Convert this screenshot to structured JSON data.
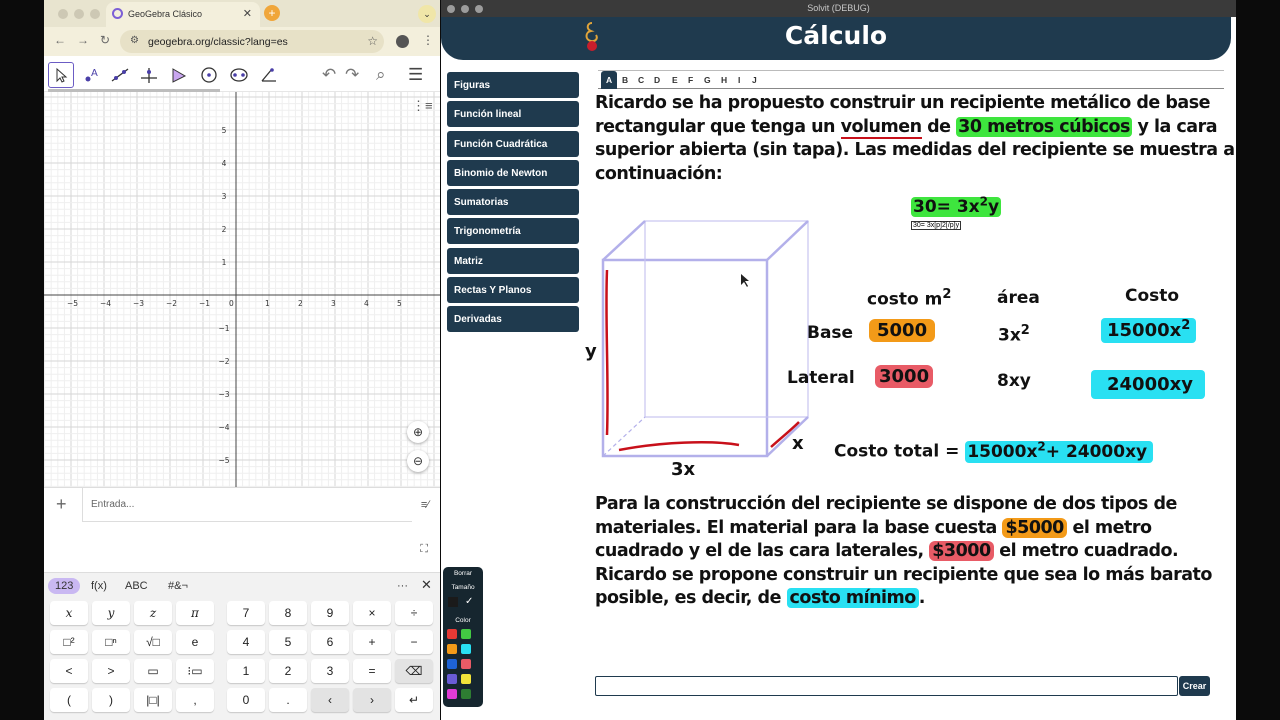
{
  "browser": {
    "tab_title": "GeoGebra Clásico",
    "url": "geogebra.org/classic?lang=es"
  },
  "geogebra": {
    "axis_x_ticks": [
      "−5",
      "−4",
      "−3",
      "−2",
      "−1",
      "0",
      "1",
      "2",
      "3",
      "4",
      "5"
    ],
    "axis_y_ticks": [
      "5",
      "4",
      "3",
      "2",
      "1",
      "−1",
      "−2",
      "−3",
      "−4",
      "−5"
    ],
    "input_placeholder": "Entrada...",
    "keyboard_tabs": [
      "123",
      "f(x)",
      "ABC",
      "#&¬"
    ],
    "keyboard_rows": [
      [
        "x",
        "y",
        "z",
        "π",
        "7",
        "8",
        "9",
        "×",
        "÷"
      ],
      [
        "□²",
        "□ⁿ",
        "√□",
        "e",
        "4",
        "5",
        "6",
        "+",
        "−"
      ],
      [
        "<",
        ">",
        "▭",
        "⁝▭",
        "1",
        "2",
        "3",
        "=",
        "⌫"
      ],
      [
        "(",
        ")",
        "|□|",
        ",",
        "0",
        ".",
        "‹",
        "›",
        "↵"
      ]
    ]
  },
  "solvit": {
    "window_title": "Solvit (DEBUG)",
    "header_title": "Cálculo",
    "menu": [
      "Figuras",
      "Función lineal",
      "Función Cuadrática",
      "Binomio de Newton",
      "Sumatorias",
      "Trigonometría",
      "Matriz",
      "Rectas Y Planos",
      "Derivadas"
    ],
    "tabs": [
      "A",
      "B",
      "C",
      "D",
      "E",
      "F",
      "G",
      "H",
      "I",
      "J"
    ],
    "p1": {
      "a": "Ricardo se ha propuesto construir un recipiente metálico de base",
      "b1": "rectangular que tenga un ",
      "b2": "volumen",
      "b3": " de ",
      "b4": "30 metros cúbicos",
      "b5": " y la cara",
      "c": "superior abierta (sin tapa). Las medidas del recipiente se muestra a",
      "d": "continuación:"
    },
    "equation": "30= 3x",
    "equation_exp": "2",
    "equation_tail": "y",
    "latex_source": "30= 3x[p]2[/p]y",
    "label_y": "y",
    "label_x": "x",
    "label_3x": "3x",
    "col_costo_m2": "costo m",
    "col_costo_m2_exp": "2",
    "col_area": "área",
    "col_costo": "Costo",
    "row_base": "Base",
    "row_lateral": "Lateral",
    "base_cost": "5000",
    "lateral_cost": "3000",
    "base_area": "3x",
    "base_area_exp": "2",
    "lateral_area": "8xy",
    "base_total": "15000x",
    "base_total_exp": "2",
    "lateral_total": "24000xy",
    "total_label": "Costo total = ",
    "total_expr_a": "15000x",
    "total_expr_exp": "2",
    "total_expr_b": "+ 24000xy",
    "p2": {
      "a": "Para la construcción del recipiente se dispone de dos tipos de",
      "b1": "materiales. El material para la base cuesta ",
      "b2": "$5000",
      "b3": " el metro",
      "c1": "cuadrado y el de las cara laterales, ",
      "c2": "$3000",
      "c3": " el metro cuadrado.",
      "d": "Ricardo se propone construir un recipiente que sea lo más barato",
      "e1": "posible, es decir, de ",
      "e2": "costo mínimo",
      "e3": "."
    },
    "create_button": "Crear"
  },
  "palette": {
    "borrar": "Borrar",
    "tamano": "Tamaño",
    "color": "Color",
    "swatches": [
      "#e53935",
      "#43c943",
      "#f39a18",
      "#29e0f2",
      "#1e63d6",
      "#e85b66",
      "#6a5cd6",
      "#f2e33a",
      "#e23bd6",
      "#2e7d32"
    ]
  }
}
